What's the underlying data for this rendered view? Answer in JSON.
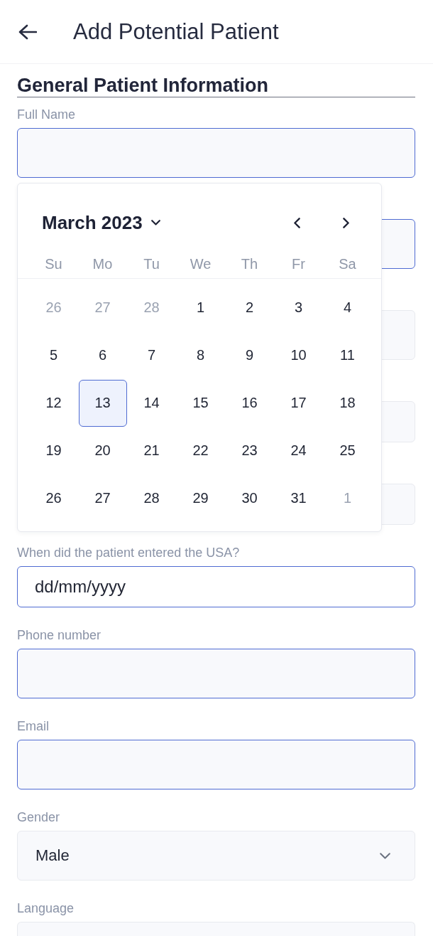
{
  "header": {
    "title": "Add Potential Patient"
  },
  "section": {
    "title": "General Patient Information"
  },
  "fields": [
    {
      "kind": "text",
      "label": "Full Name"
    },
    {
      "kind": "text"
    },
    {
      "kind": "plain"
    },
    {
      "kind": "compact"
    },
    {
      "kind": "compact"
    },
    {
      "kind": "date",
      "label": "When did the patient entered the USA?",
      "placeholder": "dd/mm/yyyy"
    },
    {
      "kind": "text",
      "label": "Phone number"
    },
    {
      "kind": "text",
      "label": "Email"
    },
    {
      "kind": "select",
      "label": "Gender",
      "value": "Male"
    },
    {
      "kind": "plain",
      "label": "Language"
    }
  ],
  "date_picker": {
    "month_label": "March 2023",
    "weekdays": [
      "Su",
      "Mo",
      "Tu",
      "We",
      "Th",
      "Fr",
      "Sa"
    ],
    "weeks": [
      [
        {
          "day": "26",
          "outside": true,
          "selected": false
        },
        {
          "day": "27",
          "outside": true,
          "selected": false
        },
        {
          "day": "28",
          "outside": true,
          "selected": false
        },
        {
          "day": "1",
          "outside": false,
          "selected": false
        },
        {
          "day": "2",
          "outside": false,
          "selected": false
        },
        {
          "day": "3",
          "outside": false,
          "selected": false
        },
        {
          "day": "4",
          "outside": false,
          "selected": false
        }
      ],
      [
        {
          "day": "5",
          "outside": false,
          "selected": false
        },
        {
          "day": "6",
          "outside": false,
          "selected": false
        },
        {
          "day": "7",
          "outside": false,
          "selected": false
        },
        {
          "day": "8",
          "outside": false,
          "selected": false
        },
        {
          "day": "9",
          "outside": false,
          "selected": false
        },
        {
          "day": "10",
          "outside": false,
          "selected": false
        },
        {
          "day": "11",
          "outside": false,
          "selected": false
        }
      ],
      [
        {
          "day": "12",
          "outside": false,
          "selected": false
        },
        {
          "day": "13",
          "outside": false,
          "selected": true
        },
        {
          "day": "14",
          "outside": false,
          "selected": false
        },
        {
          "day": "15",
          "outside": false,
          "selected": false
        },
        {
          "day": "16",
          "outside": false,
          "selected": false
        },
        {
          "day": "17",
          "outside": false,
          "selected": false
        },
        {
          "day": "18",
          "outside": false,
          "selected": false
        }
      ],
      [
        {
          "day": "19",
          "outside": false,
          "selected": false
        },
        {
          "day": "20",
          "outside": false,
          "selected": false
        },
        {
          "day": "21",
          "outside": false,
          "selected": false
        },
        {
          "day": "22",
          "outside": false,
          "selected": false
        },
        {
          "day": "23",
          "outside": false,
          "selected": false
        },
        {
          "day": "24",
          "outside": false,
          "selected": false
        },
        {
          "day": "25",
          "outside": false,
          "selected": false
        }
      ],
      [
        {
          "day": "26",
          "outside": false,
          "selected": false
        },
        {
          "day": "27",
          "outside": false,
          "selected": false
        },
        {
          "day": "28",
          "outside": false,
          "selected": false
        },
        {
          "day": "29",
          "outside": false,
          "selected": false
        },
        {
          "day": "30",
          "outside": false,
          "selected": false
        },
        {
          "day": "31",
          "outside": false,
          "selected": false
        },
        {
          "day": "1",
          "outside": true,
          "selected": false
        }
      ]
    ]
  }
}
